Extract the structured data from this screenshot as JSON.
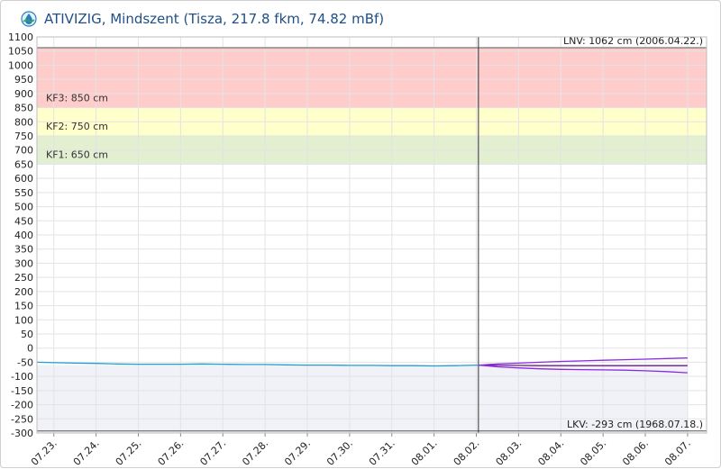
{
  "header": {
    "title": "ATIVIZIG, Mindszent (Tisza, 217.8 fkm, 74.82 mBf)"
  },
  "chart_data": {
    "type": "line",
    "title": "ATIVIZIG, Mindszent (Tisza, 217.8 fkm, 74.82 mBf)",
    "ylim": [
      -300,
      1100
    ],
    "y_ticks": [
      1100,
      1050,
      1000,
      950,
      900,
      850,
      800,
      750,
      700,
      650,
      600,
      550,
      500,
      450,
      400,
      350,
      300,
      250,
      200,
      150,
      100,
      50,
      0,
      -50,
      -100,
      -150,
      -200,
      -250,
      -300
    ],
    "x_ticks": [
      "07.23.",
      "07.24.",
      "07.25.",
      "07.26.",
      "07.27.",
      "07.28.",
      "07.29.",
      "07.30.",
      "07.31.",
      "08.01.",
      "08.02.",
      "08.03.",
      "08.04.",
      "08.05.",
      "08.06.",
      "08.07."
    ],
    "xlim_days": [
      -0.4,
      15.45
    ],
    "grid": true,
    "now_marker_day": 10.05,
    "bands": [
      {
        "label": "KF3: 850 cm",
        "from": 850,
        "to": 1062,
        "color": "#ffcccc"
      },
      {
        "label": "KF2: 750 cm",
        "from": 750,
        "to": 850,
        "color": "#ffffcc"
      },
      {
        "label": "KF1: 650 cm",
        "from": 650,
        "to": 750,
        "color": "#e2efd1"
      }
    ],
    "low_band": {
      "from": -300,
      "to": -60,
      "color": "#f1f2f7"
    },
    "reference_lines": {
      "lnv": {
        "label": "LNV: 1062 cm (2006.04.22.)",
        "value": 1062
      },
      "lkv": {
        "label": "LKV: -293 cm (1968.07.18.)",
        "value": -293
      }
    },
    "series": [
      {
        "color": "#1e9fd6",
        "x": [
          -0.4,
          0.5,
          1,
          1.5,
          2,
          2.5,
          3,
          3.5,
          4,
          4.5,
          5,
          5.5,
          6,
          6.5,
          7,
          7.5,
          8,
          8.5,
          9,
          9.5,
          10.05
        ],
        "y": [
          -50,
          -53,
          -54,
          -56,
          -57,
          -57,
          -57,
          -56,
          -57,
          -58,
          -58,
          -59,
          -60,
          -60,
          -61,
          -61,
          -62,
          -62,
          -63,
          -62,
          -60
        ]
      },
      {
        "color": "#6a1b8a",
        "x": [
          10.05,
          10.5,
          11,
          11.5,
          12,
          12.5,
          13,
          13.5,
          14,
          14.5,
          15
        ],
        "y": [
          -60,
          -61,
          -61,
          -62,
          -62,
          -62,
          -62,
          -62,
          -62,
          -62,
          -62
        ]
      },
      {
        "color": "#8a2be2",
        "x": [
          10.05,
          10.5,
          11,
          11.5,
          12,
          12.5,
          13,
          13.5,
          14,
          14.5,
          15
        ],
        "y": [
          -60,
          -56,
          -53,
          -50,
          -47,
          -45,
          -43,
          -41,
          -39,
          -37,
          -35
        ]
      },
      {
        "color": "#8a2be2",
        "x": [
          10.05,
          10.5,
          11,
          11.5,
          12,
          12.5,
          13,
          13.5,
          14,
          14.5,
          15
        ],
        "y": [
          -60,
          -66,
          -70,
          -73,
          -75,
          -76,
          -77,
          -78,
          -80,
          -83,
          -87
        ]
      }
    ]
  }
}
